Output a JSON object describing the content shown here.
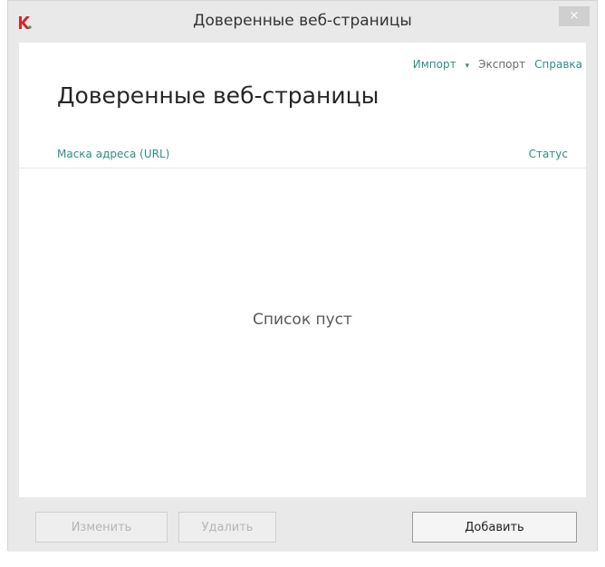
{
  "window": {
    "title": "Доверенные веб-страницы",
    "close_label": "×"
  },
  "toolbar": {
    "import_label": "Импорт",
    "export_label": "Экспорт",
    "help_label": "Справка"
  },
  "main": {
    "heading": "Доверенные веб-страницы",
    "columns": {
      "url": "Маска адреса (URL)",
      "status": "Статус"
    },
    "empty_message": "Список пуст"
  },
  "footer": {
    "edit_label": "Изменить",
    "delete_label": "Удалить",
    "add_label": "Добавить"
  },
  "colors": {
    "accent": "#2c8f82",
    "logo_red": "#d7262b"
  }
}
